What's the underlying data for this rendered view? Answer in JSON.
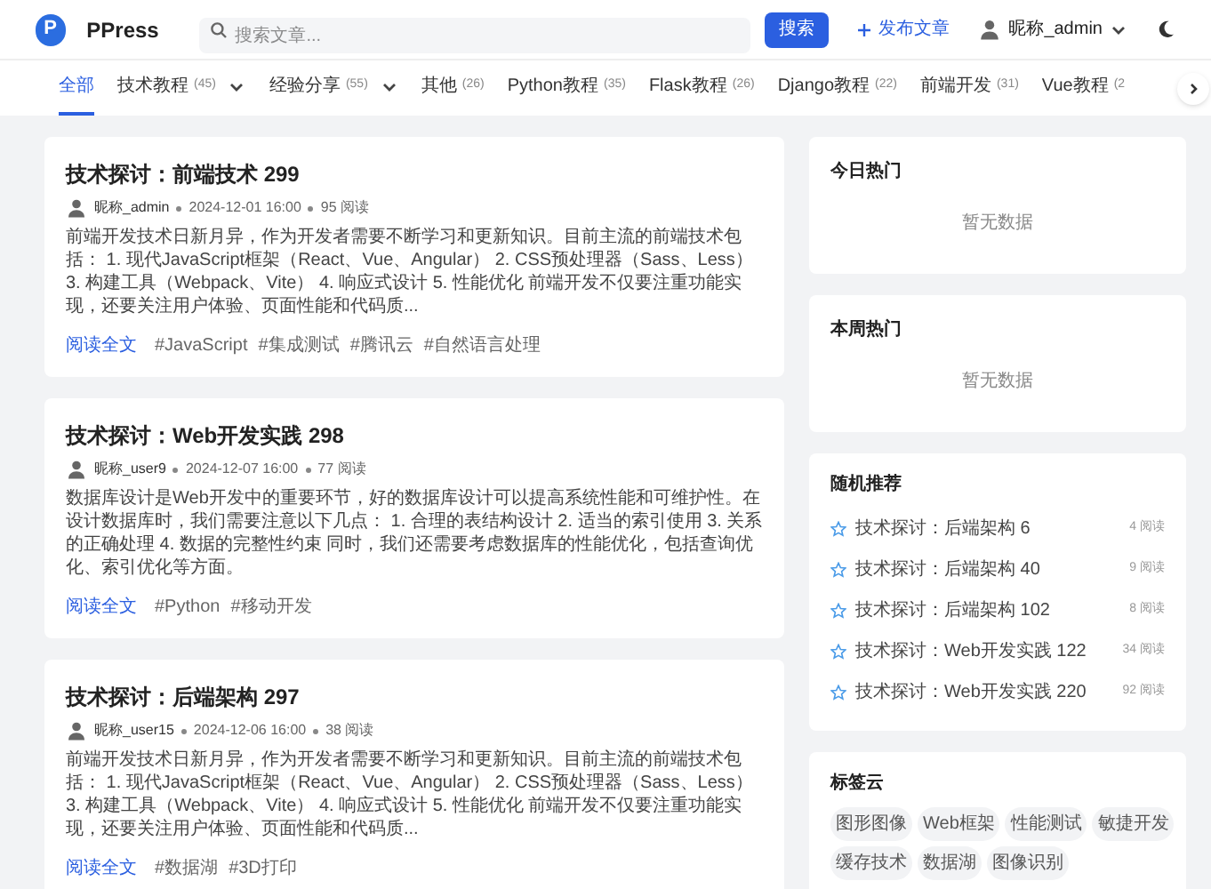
{
  "header": {
    "logo_letter": "P",
    "brand": "PPress",
    "search": {
      "placeholder": "搜索文章..."
    },
    "search_button": "搜索",
    "publish": "发布文章",
    "user": "昵称_admin"
  },
  "tabs": [
    {
      "label": "全部",
      "selected": true
    },
    {
      "label": "技术教程",
      "count": "(45)",
      "dropdown": true,
      "selected": false
    },
    {
      "label": "经验分享",
      "count": "(55)",
      "dropdown": true,
      "selected": false
    },
    {
      "label": "其他",
      "count": "(26)",
      "selected": false
    },
    {
      "label": "Python教程",
      "count": "(35)",
      "selected": false
    },
    {
      "label": "Flask教程",
      "count": "(26)",
      "selected": false
    },
    {
      "label": "Django教程",
      "count": "(22)",
      "selected": false
    },
    {
      "label": "前端开发",
      "count": "(31)",
      "selected": false
    },
    {
      "label": "Vue教程",
      "count": "(2",
      "selected": false
    }
  ],
  "posts": [
    {
      "title": "技术探讨：前端技术 299",
      "author": "昵称_admin",
      "date": "2024-12-01 16:00",
      "reads": "95 阅读",
      "excerpt": "前端开发技术日新月异，作为开发者需要不断学习和更新知识。目前主流的前端技术包括： 1. 现代JavaScript框架（React、Vue、Angular） 2. CSS预处理器（Sass、Less） 3. 构建工具（Webpack、Vite） 4. 响应式设计 5. 性能优化 前端开发不仅要注重功能实现，还要关注用户体验、页面性能和代码质...",
      "read_more": "阅读全文",
      "tags": [
        "#JavaScript",
        "#集成测试",
        "#腾讯云",
        "#自然语言处理"
      ]
    },
    {
      "title": "技术探讨：Web开发实践 298",
      "author": "昵称_user9",
      "date": "2024-12-07 16:00",
      "reads": "77 阅读",
      "excerpt": "数据库设计是Web开发中的重要环节，好的数据库设计可以提高系统性能和可维护性。在设计数据库时，我们需要注意以下几点： 1. 合理的表结构设计 2. 适当的索引使用 3. 关系的正确处理 4. 数据的完整性约束 同时，我们还需要考虑数据库的性能优化，包括查询优化、索引优化等方面。",
      "read_more": "阅读全文",
      "tags": [
        "#Python",
        "#移动开发"
      ]
    },
    {
      "title": "技术探讨：后端架构 297",
      "author": "昵称_user15",
      "date": "2024-12-06 16:00",
      "reads": "38 阅读",
      "excerpt": "前端开发技术日新月异，作为开发者需要不断学习和更新知识。目前主流的前端技术包括： 1. 现代JavaScript框架（React、Vue、Angular） 2. CSS预处理器（Sass、Less） 3. 构建工具（Webpack、Vite） 4. 响应式设计 5. 性能优化 前端开发不仅要注重功能实现，还要关注用户体验、页面性能和代码质...",
      "read_more": "阅读全文",
      "tags": [
        "#数据湖",
        "#3D打印"
      ]
    }
  ],
  "sidebar": {
    "today": {
      "title": "今日热门",
      "empty": "暂无数据"
    },
    "week": {
      "title": "本周热门",
      "empty": "暂无数据"
    },
    "random": {
      "title": "随机推荐",
      "items": [
        {
          "title": "技术探讨：后端架构 6",
          "reads": "4 阅读"
        },
        {
          "title": "技术探讨：后端架构 40",
          "reads": "9 阅读"
        },
        {
          "title": "技术探讨：后端架构 102",
          "reads": "8 阅读"
        },
        {
          "title": "技术探讨：Web开发实践 122",
          "reads": "34 阅读"
        },
        {
          "title": "技术探讨：Web开发实践 220",
          "reads": "92 阅读"
        }
      ]
    },
    "tag_cloud": {
      "title": "标签云",
      "tags": [
        "图形图像",
        "Web框架",
        "性能测试",
        "敏捷开发",
        "缓存技术",
        "数据湖",
        "图像识别"
      ]
    }
  }
}
